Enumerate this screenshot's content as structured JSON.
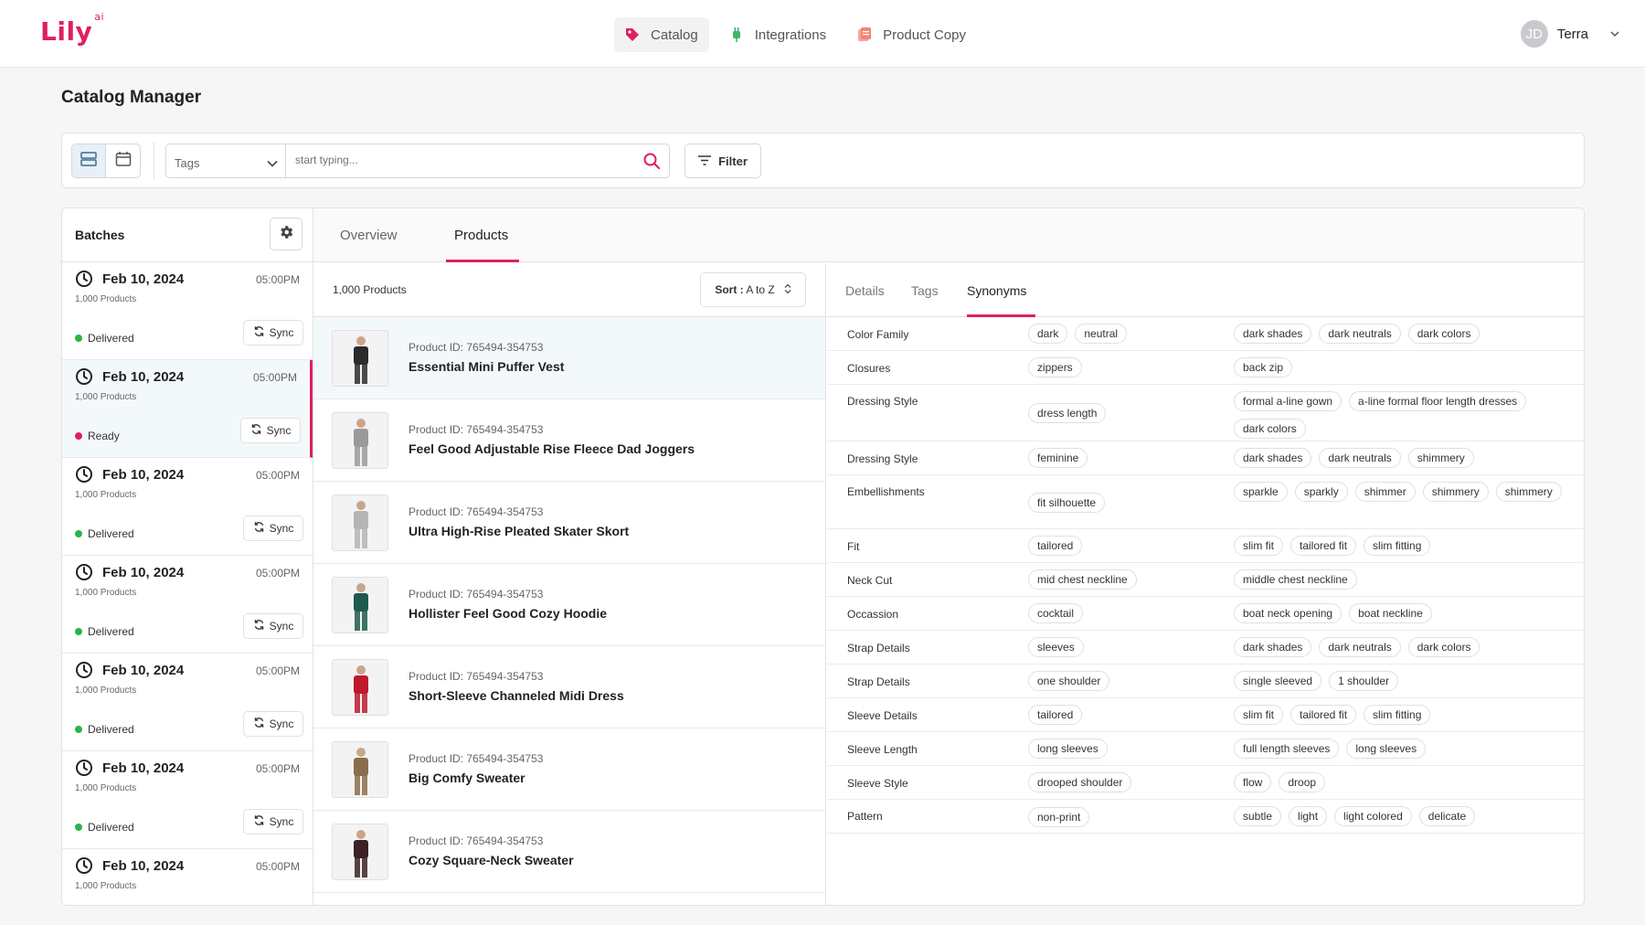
{
  "app": {
    "logo_text": "Lily",
    "logo_sup": "ai",
    "brand_color": "#e0205f"
  },
  "nav": {
    "items": [
      {
        "label": "Catalog",
        "icon": "tag-icon",
        "active": true
      },
      {
        "label": "Integrations",
        "icon": "plug-icon",
        "active": false
      },
      {
        "label": "Product Copy",
        "icon": "document-icon",
        "active": false
      }
    ]
  },
  "user": {
    "initials": "JD",
    "name": "Terra"
  },
  "page": {
    "title": "Catalog Manager"
  },
  "toolbar": {
    "tags_select": "Tags",
    "search_placeholder": "start typing...",
    "filter_label": "Filter"
  },
  "batches": {
    "title": "Batches",
    "sync_label": "Sync",
    "items": [
      {
        "date": "Feb 10, 2024",
        "time": "05:00PM",
        "count": "1,000 Products",
        "status": "Delivered",
        "status_color": "#2bb34a"
      },
      {
        "date": "Feb 10, 2024",
        "time": "05:00PM",
        "count": "1,000 Products",
        "status": "Ready",
        "status_color": "#e0205f"
      },
      {
        "date": "Feb 10, 2024",
        "time": "05:00PM",
        "count": "1,000 Products",
        "status": "Delivered",
        "status_color": "#2bb34a"
      },
      {
        "date": "Feb 10, 2024",
        "time": "05:00PM",
        "count": "1,000 Products",
        "status": "Delivered",
        "status_color": "#2bb34a"
      },
      {
        "date": "Feb 10, 2024",
        "time": "05:00PM",
        "count": "1,000 Products",
        "status": "Delivered",
        "status_color": "#2bb34a"
      },
      {
        "date": "Feb 10, 2024",
        "time": "05:00PM",
        "count": "1,000 Products",
        "status": "Delivered",
        "status_color": "#2bb34a"
      },
      {
        "date": "Feb 10, 2024",
        "time": "05:00PM",
        "count": "1,000 Products"
      }
    ]
  },
  "main_tabs": [
    {
      "label": "Overview"
    },
    {
      "label": "Products"
    }
  ],
  "products": {
    "count_label": "1,000 Products",
    "sort_prefix": "Sort :",
    "sort_value": "A to Z",
    "items": [
      {
        "id": "Product ID: 765494-354753",
        "name": "Essential Mini Puffer Vest",
        "thumb_color": "#2b2b2b"
      },
      {
        "id": "Product ID: 765494-354753",
        "name": "Feel Good Adjustable Rise Fleece Dad Joggers",
        "thumb_color": "#9a9a9a"
      },
      {
        "id": "Product ID: 765494-354753",
        "name": "Ultra High-Rise Pleated Skater Skort",
        "thumb_color": "#b4b4b4"
      },
      {
        "id": "Product ID: 765494-354753",
        "name": "Hollister Feel Good Cozy Hoodie",
        "thumb_color": "#1e5a4e"
      },
      {
        "id": "Product ID: 765494-354753",
        "name": "Short-Sleeve Channeled Midi Dress",
        "thumb_color": "#c0182d"
      },
      {
        "id": "Product ID: 765494-354753",
        "name": "Big Comfy Sweater",
        "thumb_color": "#8b6d4b"
      },
      {
        "id": "Product ID: 765494-354753",
        "name": "Cozy Square-Neck Sweater",
        "thumb_color": "#3a2226"
      }
    ]
  },
  "detail_tabs": [
    {
      "label": "Details"
    },
    {
      "label": "Tags"
    },
    {
      "label": "Synonyms"
    }
  ],
  "synonyms": [
    {
      "label": "Color Family",
      "tags": [
        "dark",
        "neutral"
      ],
      "synonyms": [
        "dark shades",
        "dark neutrals",
        "dark colors"
      ]
    },
    {
      "label": "Closures",
      "tags": [
        "zippers"
      ],
      "synonyms": [
        "back zip"
      ]
    },
    {
      "label": "Dressing Style",
      "tags": [
        "dress length"
      ],
      "synonyms": [
        "formal a-line gown",
        "a-line formal floor length dresses",
        "dark colors"
      ]
    },
    {
      "label": "Dressing Style",
      "tags": [
        "feminine"
      ],
      "synonyms": [
        "dark shades",
        "dark neutrals",
        "shimmery"
      ]
    },
    {
      "label": "Embellishments",
      "tags": [
        "fit silhouette"
      ],
      "synonyms": [
        "sparkle",
        "sparkly",
        "shimmer",
        "shimmery",
        "shimmery"
      ]
    },
    {
      "label": "Fit",
      "tags": [
        "tailored"
      ],
      "synonyms": [
        "slim fit",
        "tailored fit",
        "slim fitting"
      ]
    },
    {
      "label": "Neck Cut",
      "tags": [
        "mid chest neckline"
      ],
      "synonyms": [
        "middle chest neckline"
      ]
    },
    {
      "label": "Occassion",
      "tags": [
        "cocktail"
      ],
      "synonyms": [
        "boat neck opening",
        "boat neckline"
      ]
    },
    {
      "label": "Strap Details",
      "tags": [
        "sleeves"
      ],
      "synonyms": [
        "dark shades",
        "dark neutrals",
        "dark colors"
      ]
    },
    {
      "label": "Strap Details",
      "tags": [
        "one shoulder"
      ],
      "synonyms": [
        "single sleeved",
        "1 shoulder"
      ]
    },
    {
      "label": "Sleeve Details",
      "tags": [
        "tailored"
      ],
      "synonyms": [
        "slim fit",
        "tailored fit",
        "slim fitting"
      ]
    },
    {
      "label": "Sleeve Length",
      "tags": [
        "long sleeves"
      ],
      "synonyms": [
        "full length sleeves",
        "long sleeves"
      ]
    },
    {
      "label": "Sleeve Style",
      "tags": [
        "drooped shoulder"
      ],
      "synonyms": [
        "flow",
        "droop"
      ]
    },
    {
      "label": "Pattern",
      "tags": [
        "non-print"
      ],
      "synonyms": [
        "subtle",
        "light",
        "light colored",
        "delicate"
      ]
    }
  ]
}
